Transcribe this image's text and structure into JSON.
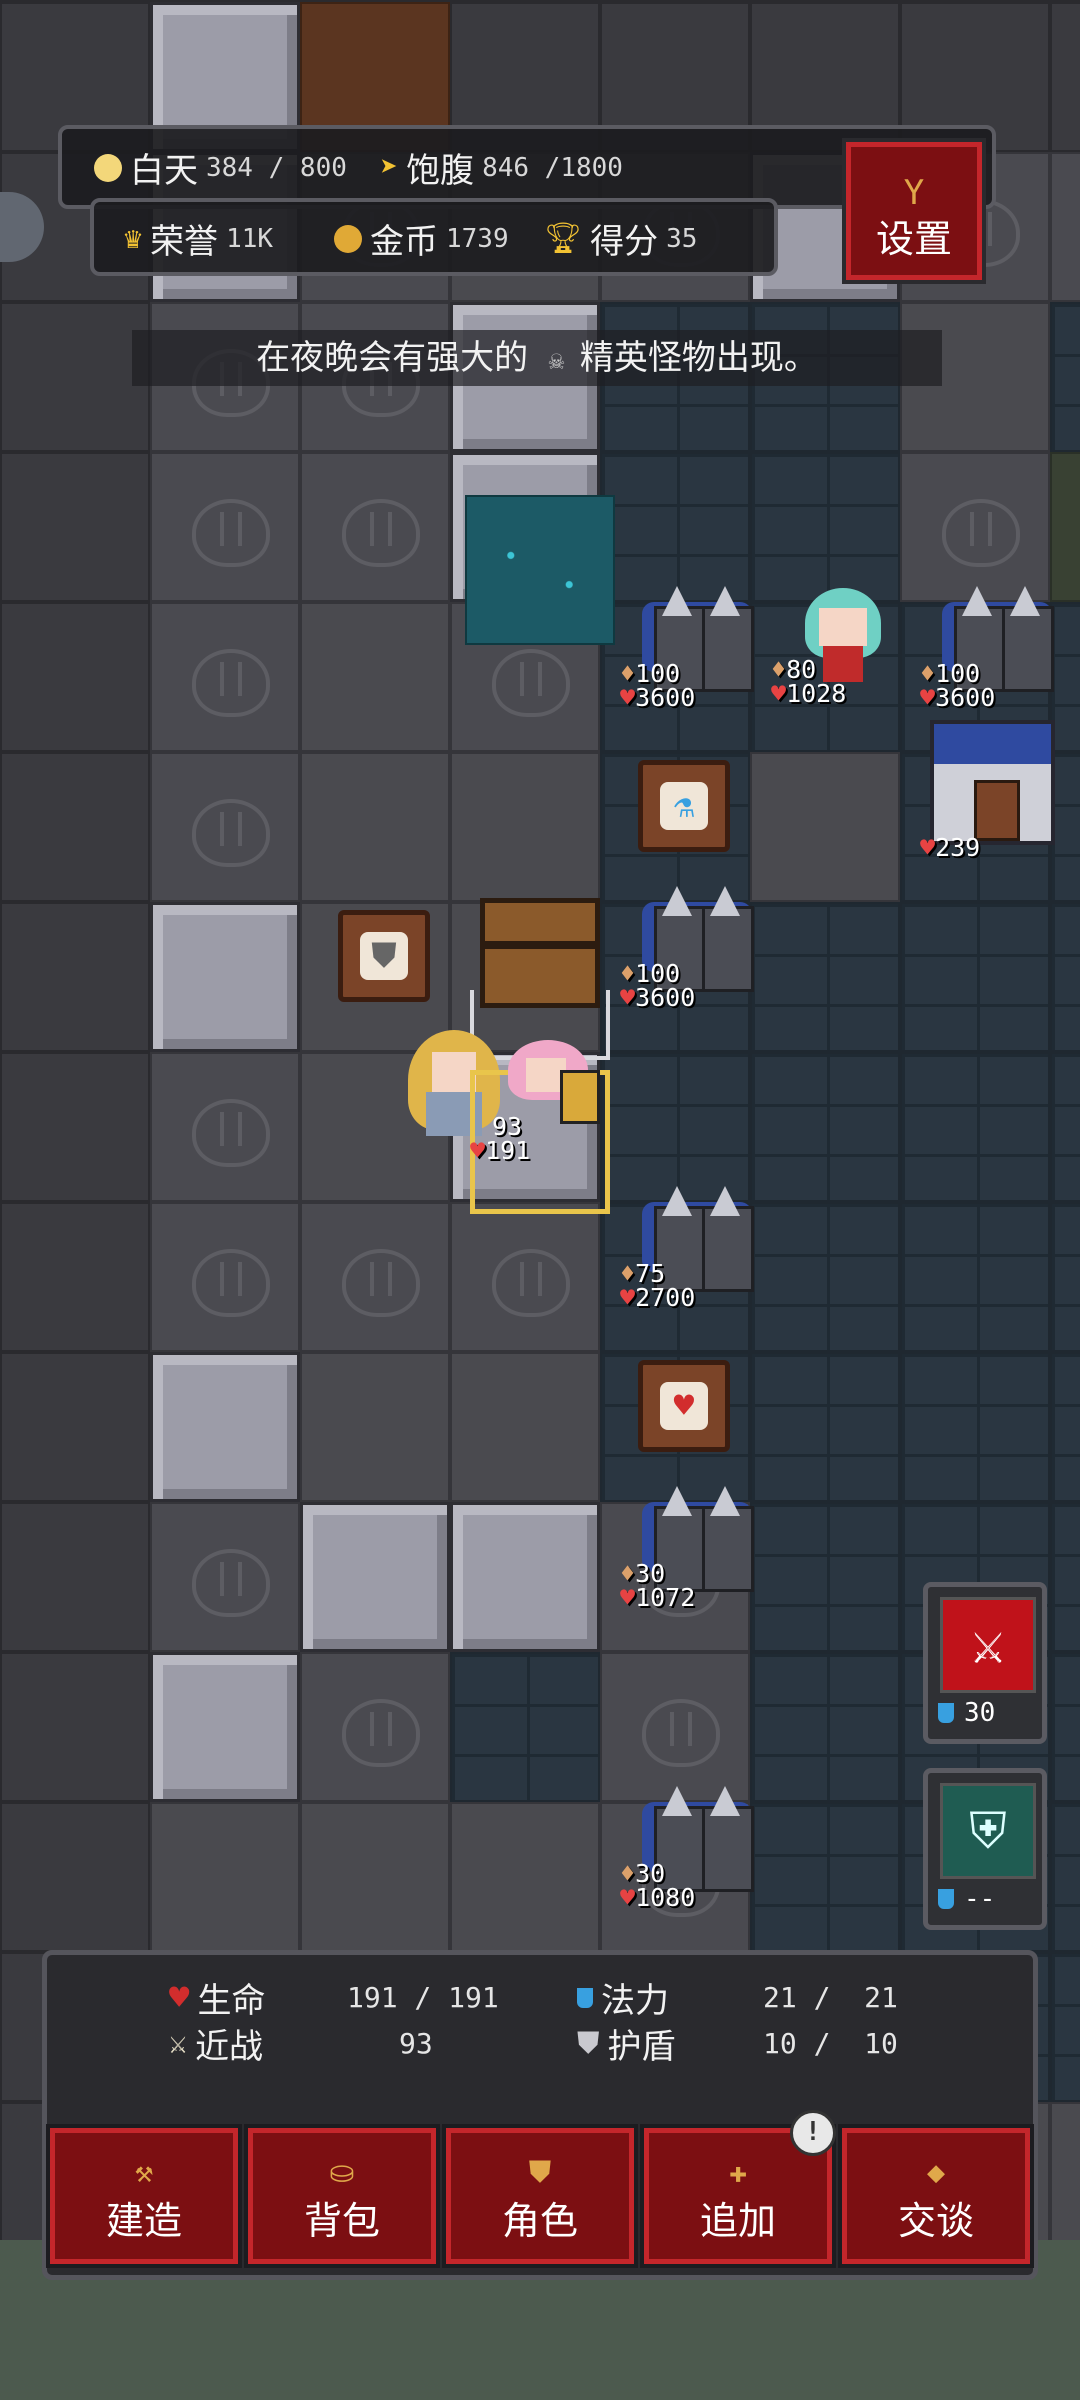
{
  "hud": {
    "day_label": "白天",
    "day_value": "384 / 800",
    "satiety_label": "饱腹",
    "satiety_value": "846 /1800",
    "honor_label": "荣誉",
    "honor_value": "11K",
    "gold_label": "金币",
    "gold_value": "1739",
    "score_label": "得分",
    "score_value": "35",
    "settings_label": "设置"
  },
  "message": {
    "text_before": "在夜晚会有强大的",
    "text_after": "精英怪物出现。"
  },
  "units": [
    {
      "atk": "100",
      "hp": "3600"
    },
    {
      "atk": "80",
      "hp": "1028"
    },
    {
      "atk": "100",
      "hp": "3600"
    },
    {
      "atk": "",
      "hp": "239"
    },
    {
      "atk": "100",
      "hp": "3600"
    },
    {
      "atk": "93",
      "hp": "191"
    },
    {
      "atk": "75",
      "hp": "2700"
    },
    {
      "atk": "30",
      "hp": "1072"
    },
    {
      "atk": "30",
      "hp": "1080"
    }
  ],
  "skills": [
    {
      "name": "sword-skill",
      "cost": "30"
    },
    {
      "name": "shield-skill",
      "cost": "--"
    }
  ],
  "stats": {
    "hp_label": "生命",
    "hp_value": "191 / 191",
    "mp_label": "法力",
    "mp_value": "21 /  21",
    "melee_label": "近战",
    "melee_value": "93",
    "shield_label": "护盾",
    "shield_value": "10 /  10"
  },
  "buttons": [
    {
      "label": "建造",
      "icon": "hammer-icon"
    },
    {
      "label": "背包",
      "icon": "bag-icon"
    },
    {
      "label": "角色",
      "icon": "shield-icon"
    },
    {
      "label": "追加",
      "icon": "plus-icon"
    },
    {
      "label": "交谈",
      "icon": "speech-icon"
    }
  ],
  "badge": "!",
  "colors": {
    "button_red": "#7c0f12",
    "button_border": "#c4262b",
    "selection": "#e9c54b",
    "heart": "#d22d2d",
    "mana": "#38a0e0"
  }
}
